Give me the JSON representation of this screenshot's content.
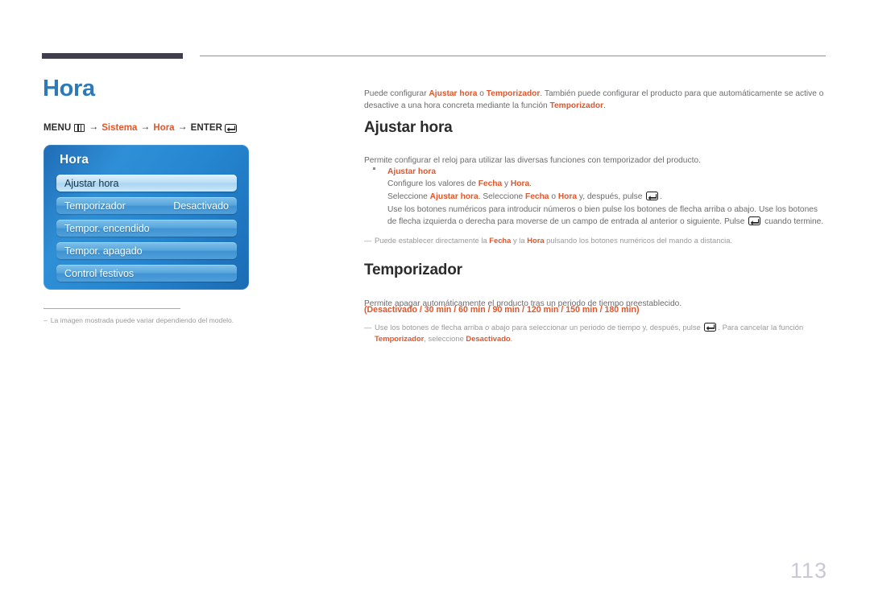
{
  "page": {
    "title": "Hora",
    "number": "113"
  },
  "breadcrumb": {
    "menu_label": "MENU",
    "menu_icon": "menu-grid-icon",
    "arrow": "→",
    "step1": "Sistema",
    "step2": "Hora",
    "enter_label": "ENTER",
    "enter_icon": "enter-key-icon"
  },
  "osd": {
    "title": "Hora",
    "items": [
      {
        "label": "Ajustar hora",
        "value": "",
        "selected": true
      },
      {
        "label": "Temporizador",
        "value": "Desactivado",
        "selected": false
      },
      {
        "label": "Tempor. encendido",
        "value": "",
        "selected": false
      },
      {
        "label": "Tempor. apagado",
        "value": "",
        "selected": false
      },
      {
        "label": "Control festivos",
        "value": "",
        "selected": false
      }
    ]
  },
  "figure_note": {
    "dash": "–",
    "text": "La imagen mostrada puede variar dependiendo del modelo."
  },
  "intro": {
    "part1": "Puede configurar ",
    "hl1": "Ajustar hora",
    "part2": " o ",
    "hl2": "Temporizador",
    "part3": ". También puede configurar el producto para que automáticamente se active o desactive a una hora concreta mediante la función ",
    "hl3": "Temporizador",
    "part4": "."
  },
  "section_ajustar": {
    "heading": "Ajustar hora",
    "lead": "Permite configurar el reloj para utilizar las diversas funciones con temporizador del producto.",
    "bullet_title": "Ajustar hora",
    "line1": {
      "a": "Configure los valores de ",
      "hl1": "Fecha",
      "b": " y ",
      "hl2": "Hora",
      "c": "."
    },
    "line2": {
      "a": "Seleccione ",
      "hl1": "Ajustar hora",
      "b": ". Seleccione ",
      "hl2": "Fecha",
      "c": " o ",
      "hl3": "Hora",
      "d": " y, después, pulse ",
      "e": "."
    },
    "line3": "Use los botones numéricos para introducir números o bien pulse los botones de flecha arriba o abajo. Use los botones de flecha izquierda o derecha para moverse de un campo de entrada al anterior o siguiente. Pulse ",
    "line3_tail": " cuando termine.",
    "note": {
      "emdash": "—",
      "a": "Puede establecer directamente la ",
      "hl1": "Fecha",
      "b": " y la ",
      "hl2": "Hora",
      "c": " pulsando los botones numéricos del mando a distancia."
    }
  },
  "section_temporizador": {
    "heading": "Temporizador",
    "lead": "Permite apagar automáticamente el producto tras un periodo de tiempo preestablecido.",
    "options": "(Desactivado / 30 min / 60 min / 90 min / 120 min / 150 min / 180 min)",
    "note": {
      "emdash": "—",
      "a": "Use los botones de flecha arriba o abajo para seleccionar un periodo de tiempo y, después, pulse ",
      "b": ". Para cancelar la función ",
      "hl1": "Temporizador",
      "c": ", seleccione ",
      "hl2": "Desactivado",
      "d": "."
    }
  },
  "colors": {
    "accent_orange": "#e1562b",
    "title_blue": "#2e79b8",
    "osd_blue": "#2585cf",
    "page_number_gray": "#c9c9d6"
  }
}
